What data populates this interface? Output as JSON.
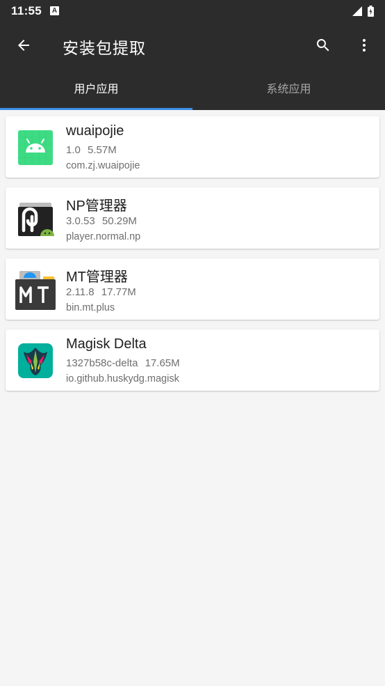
{
  "status_bar": {
    "time": "11:55",
    "notification_letter": "A"
  },
  "app_bar": {
    "title": "安装包提取"
  },
  "tabs": [
    {
      "label": "用户应用",
      "active": true
    },
    {
      "label": "系统应用",
      "active": false
    }
  ],
  "apps": [
    {
      "name": "wuaipojie",
      "version": "1.0",
      "size": "5.57M",
      "package": "com.zj.wuaipojie",
      "icon": "android-icon"
    },
    {
      "name": "NP管理器",
      "version": "3.0.53",
      "size": "50.29M",
      "package": "player.normal.np",
      "icon": "np-manager-icon"
    },
    {
      "name": "MT管理器",
      "version": "2.11.8",
      "size": "17.77M",
      "package": "bin.mt.plus",
      "icon": "mt-manager-icon"
    },
    {
      "name": "Magisk Delta",
      "version": "1327b58c-delta",
      "size": "17.65M",
      "package": "io.github.huskydg.magisk",
      "icon": "magisk-icon"
    }
  ],
  "colors": {
    "toolbar": "#2c2c2c",
    "accent": "#3d8ee6",
    "background": "#f5f5f5"
  }
}
